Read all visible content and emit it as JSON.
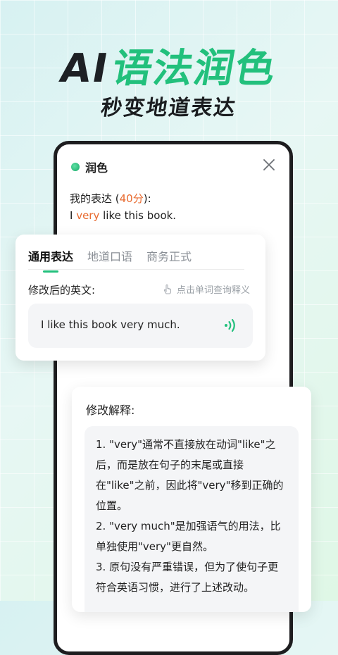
{
  "headline": {
    "ai": "AI",
    "rest": "语法润色"
  },
  "subheadline": "秒变地道表达",
  "panel": {
    "title": "润色",
    "original_label_prefix": "我的表达 (",
    "original_score": "40分",
    "original_label_suffix": "):",
    "original_sentence": {
      "before": "I ",
      "highlight": "very",
      "after": " like this book."
    }
  },
  "tabs": [
    "通用表达",
    "地道口语",
    "商务正式"
  ],
  "revised": {
    "label": "修改后的英文:",
    "hint": "点击单词查询释义",
    "sentence": "I like this book very much."
  },
  "explanation": {
    "label": "修改解释:",
    "lines": [
      "1. \"very\"通常不直接放在动词\"like\"之",
      "后，而是放在句子的末尾或直接",
      "在\"like\"之前，因此将\"very\"移到正确的",
      "位置。",
      "2. \"very much\"是加强语气的用法，比",
      "单独使用\"very\"更自然。",
      "3. 原句没有严重错误，但为了使句子更",
      "符合英语习惯，进行了上述改动。"
    ]
  },
  "colors": {
    "accent": "#22c07c",
    "highlight": "#e86a2f",
    "dark": "#1d2024"
  }
}
